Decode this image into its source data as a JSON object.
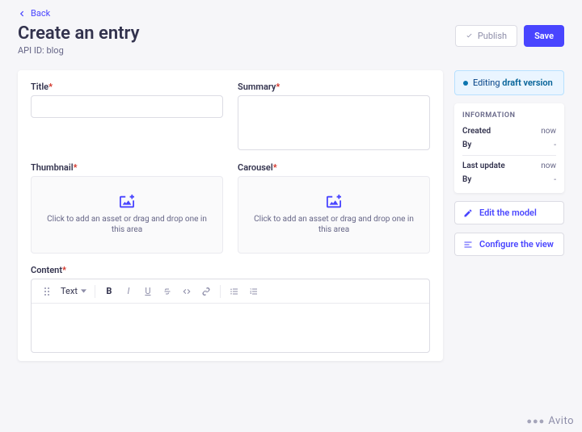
{
  "nav": {
    "back": "Back"
  },
  "header": {
    "title": "Create an entry",
    "api_id_label": "API ID: blog",
    "publish": "Publish",
    "save": "Save"
  },
  "fields": {
    "title_label": "Title",
    "summary_label": "Summary",
    "thumbnail_label": "Thumbnail",
    "carousel_label": "Carousel",
    "content_label": "Content",
    "asset_caption": "Click to add an asset or drag and drop one in this area",
    "title_value": "",
    "summary_value": ""
  },
  "rte": {
    "dropdown_label": "Text"
  },
  "sidebar": {
    "status_prefix": "Editing ",
    "status_version": "draft version",
    "info_heading": "INFORMATION",
    "created_label": "Created",
    "created_value": "now",
    "created_by_label": "By",
    "created_by_value": "-",
    "updated_label": "Last update",
    "updated_value": "now",
    "updated_by_label": "By",
    "updated_by_value": "-",
    "edit_model": "Edit the model",
    "configure_view": "Configure the view"
  },
  "watermark": {
    "text": "Avito"
  }
}
